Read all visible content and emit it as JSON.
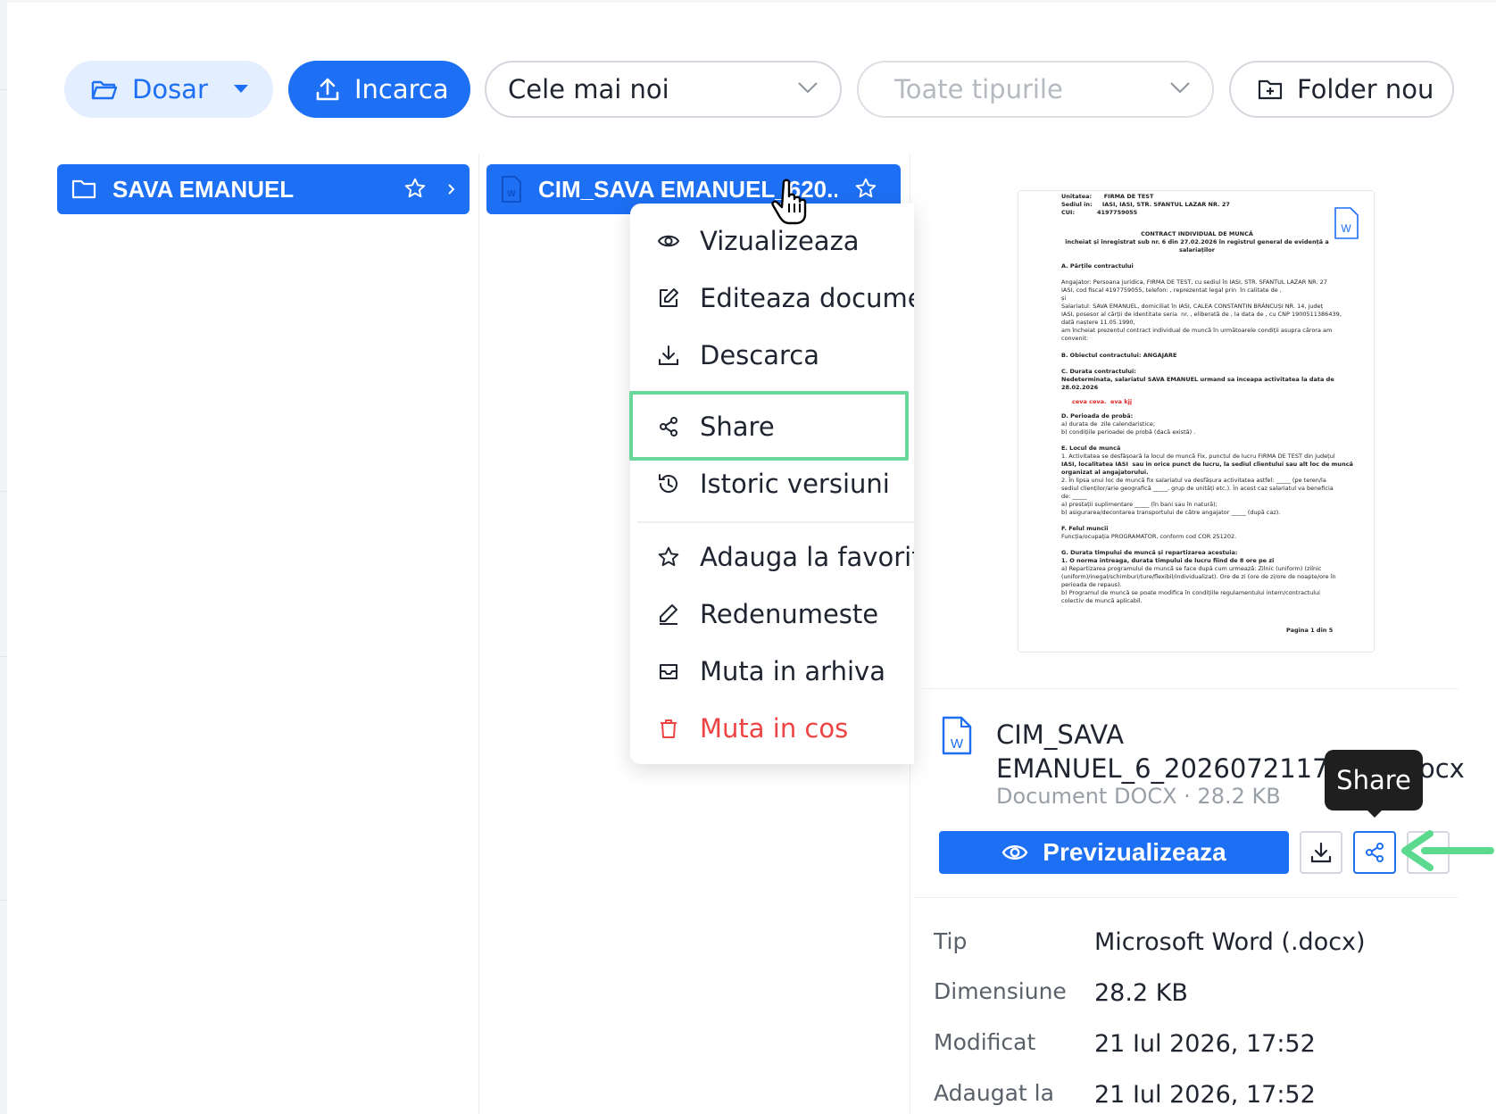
{
  "toolbar": {
    "dosar_label": "Dosar",
    "upload_label": "Incarca",
    "sort_value": "Cele mai noi",
    "type_placeholder": "Toate tipurile",
    "new_folder_label": "Folder nou"
  },
  "columns": {
    "folder_item": "SAVA EMANUEL",
    "file_item": "CIM_SAVA EMANUEL_620..."
  },
  "context_menu": {
    "items": [
      {
        "label": "Vizualizeaza",
        "icon": "eye-icon"
      },
      {
        "label": "Editeaza documen",
        "icon": "edit-icon"
      },
      {
        "label": "Descarca",
        "icon": "download-icon"
      },
      {
        "label": "Share",
        "icon": "share-icon"
      },
      {
        "label": "Istoric versiuni",
        "icon": "history-icon"
      },
      {
        "label": "Adauga la favorite",
        "icon": "star-icon"
      },
      {
        "label": "Redenumeste",
        "icon": "pencil-icon"
      },
      {
        "label": "Muta in arhiva",
        "icon": "archive-icon"
      },
      {
        "label": "Muta in cos",
        "icon": "trash-icon"
      }
    ]
  },
  "preview": {
    "doc_lines": {
      "l1": "Unitatea:      FIRMA DE TEST",
      "l2": "Sediul in:     IASI, IASI, STR. SFANTUL LAZAR NR. 27",
      "l3": "CUI:           4197759055",
      "t1": "CONTRACT INDIVIDUAL DE MUNCĂ",
      "t2": "încheiat și înregistrat sub nr. 6 din 27.02.2026 în registrul general de evidență a",
      "t3": "salariaților",
      "s1": "A. Părțile contractului",
      "p1": "Angajator: Persoana juridica, FIRMA DE TEST, cu sediul în IASI, STR. SFANTUL LAZAR NR. 27",
      "p2": "IASI, cod fiscal 4197759055, telefon: , reprezentat legal prin  în calitate de ,",
      "p3": "și",
      "p4": "Salariatul: SAVA EMANUEL, domiciliat în IASI, CALEA CONSTANTIN BRÂNCUȘI NR. 14, județ",
      "p5": "IASI, posesor al cărții de identitate seria  nr. , eliberată de , la data de , cu CNP 1900511386439,",
      "p6": "dată naștere 11.05.1990,",
      "p7": "am încheiat prezentul contract individual de muncă în următoarele condiții asupra cărora am",
      "p8": "convenit:",
      "s2": "B. Obiectul contractului: ANGAJARE",
      "s3": "C. Durata contractului:",
      "p9": "Nedeterminata, salariatul SAVA EMANUEL urmand sa inceapa activitatea la data de",
      "p10": "28.02.2026",
      "red": "ceva ceva.  eva kjj",
      "s4": "D. Perioada de probă:",
      "p11": "a) durata de  zile calendaristice;",
      "p12": "b) condițiile perioadei de probă (dacă există) .",
      "s5": "E. Locul de muncă",
      "p13": "1. Activitatea se desfășoară la locul de muncă Fix, punctul de lucru FIRMA DE TEST din județul",
      "p14": "IASI, localitatea IASI  sau in orice punct de lucru, la sediul clientului sau alt loc de muncă",
      "p15": "organizat al angajatorului.",
      "p16": "2. În lipsa unui loc de muncă fix salariatul va desfășura activitatea astfel: _____ (pe teren/la",
      "p17": "sediul clienților/arie geografică _____, grup de unități etc.). În acest caz salariatul va beneficia",
      "p18": "de: _____",
      "p19": "a) prestații suplimentare _____ (în bani sau în natură);",
      "p20": "b) asigurarea/decontarea transportului de către angajator _____ (după caz).",
      "s6": "F. Felul muncii",
      "p21": "Funcția/ocupația PROGRAMATOR, conform cod COR 251202.",
      "s7": "G. Durata timpului de muncă și repartizarea acestuia:",
      "p22": "1. O norma intreaga, durata timpului de lucru fiind de 8 ore pe zi",
      "p23": "a) Repartizarea programului de muncă se face după cum urmează: Zilnic (uniform) (zilnic",
      "p24": "(uniform)/inegal/schimburi/ture/flexibil/individualizat). Ore de zi (ore de zi/ore de noapte/ore în",
      "p25": "perioada de repaus).",
      "p26": "b) Programul de muncă se poate modifica în condițiile regulamentului intern/contractului",
      "p27": "colectiv de muncă aplicabil.",
      "page": "Pagina 1 din 5"
    },
    "file_name_line1": "CIM_SAVA",
    "file_name_line2": "EMANUEL_6_20260721175207.docx",
    "file_meta": "Document DOCX · 28.2 KB",
    "preview_button": "Previzualizeaza",
    "tooltip": "Share"
  },
  "properties": [
    {
      "label": "Tip",
      "value": "Microsoft Word (.docx)"
    },
    {
      "label": "Dimensiune",
      "value": "28.2 KB"
    },
    {
      "label": "Modificat",
      "value": "21 Iul 2026, 17:52"
    },
    {
      "label": "Adaugat la",
      "value": "21 Iul 2026, 17:52"
    }
  ],
  "colors": {
    "primary": "#1d6ff3",
    "primary_light": "#e3eefe",
    "danger": "#ef4444",
    "highlight": "#6ad79a",
    "tooltip_bg": "#1f1f1f"
  }
}
